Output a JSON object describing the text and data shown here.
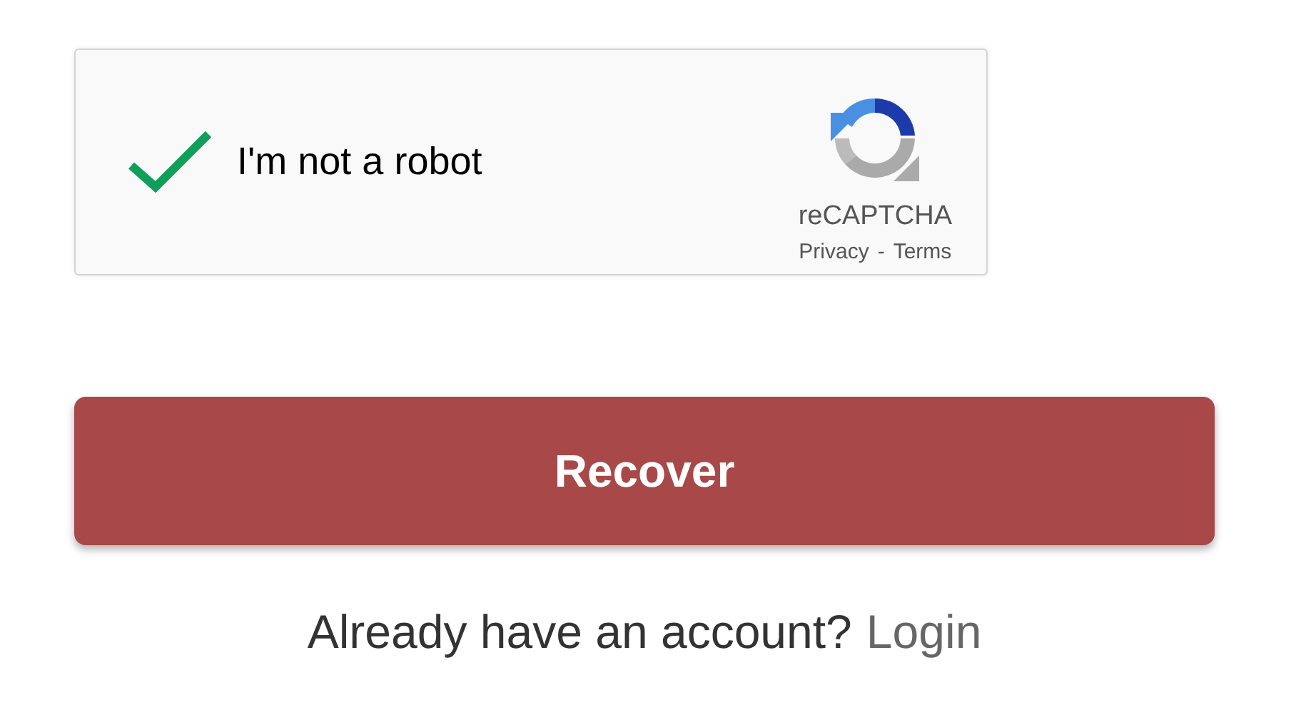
{
  "captcha": {
    "label": "I'm not a robot",
    "checked": true,
    "brand": "reCAPTCHA",
    "links": [
      "Privacy",
      "Terms"
    ],
    "separator": "-"
  },
  "button": {
    "label": "Recover"
  },
  "footer": {
    "text": "Already have an account?",
    "link": "Login"
  }
}
